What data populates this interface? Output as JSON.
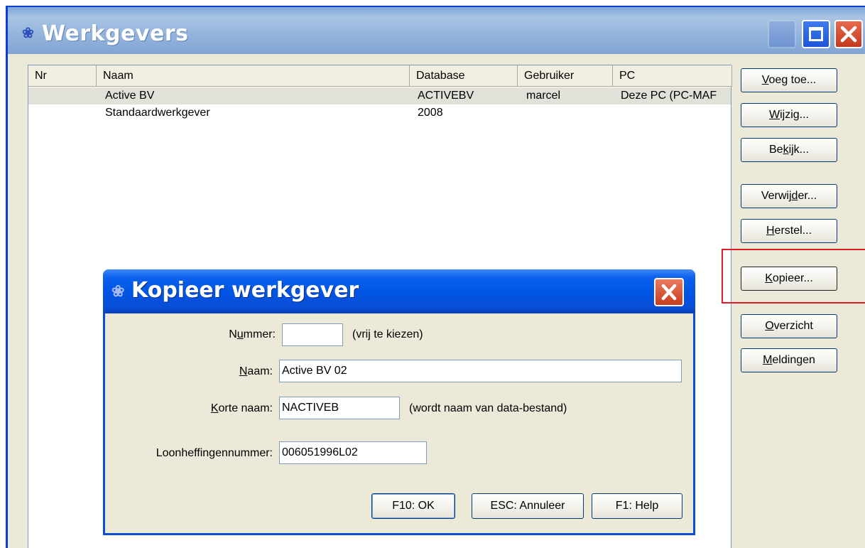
{
  "main": {
    "title": "Werkgevers",
    "columns": [
      "Nr",
      "Naam",
      "Database",
      "Gebruiker",
      "PC"
    ],
    "rows": [
      {
        "nr": "",
        "naam": "Active BV",
        "database": "ACTIVEBV",
        "gebruiker": "marcel",
        "pc": "Deze PC (PC-MAF"
      },
      {
        "nr": "",
        "naam": "Standaardwerkgever",
        "database": "2008",
        "gebruiker": "",
        "pc": ""
      }
    ],
    "buttons": {
      "voeg_toe": {
        "pre": "",
        "key": "V",
        "post": "oeg toe..."
      },
      "wijzig": {
        "pre": "",
        "key": "W",
        "post": "ijzig..."
      },
      "bekijk": {
        "pre": "Be",
        "key": "k",
        "post": "ijk..."
      },
      "verwijder": {
        "pre": "Verwij",
        "key": "d",
        "post": "er..."
      },
      "herstel": {
        "pre": "",
        "key": "H",
        "post": "erstel..."
      },
      "kopieer": {
        "pre": "",
        "key": "K",
        "post": "opieer..."
      },
      "overzicht": {
        "pre": "",
        "key": "O",
        "post": "verzicht"
      },
      "meldingen": {
        "pre": "",
        "key": "M",
        "post": "eldingen"
      }
    }
  },
  "dialog": {
    "title": "Kopieer werkgever",
    "nummer": {
      "label_pre": "N",
      "label_key": "u",
      "label_post": "mmer:",
      "value": "",
      "hint": "(vrij te kiezen)"
    },
    "naam": {
      "label_pre": "",
      "label_key": "N",
      "label_post": "aam:",
      "value": "Active BV 02"
    },
    "korte_naam": {
      "label_pre": "",
      "label_key": "K",
      "label_post": "orte naam:",
      "value": "NACTIVEB",
      "hint": "(wordt naam van data-bestand)"
    },
    "loonheffingennummer": {
      "label": "Loonheffingennummer:",
      "value": "006051996L02"
    },
    "buttons": {
      "ok": "F10: OK",
      "cancel": "ESC: Annuleer",
      "help": "F1: Help"
    }
  },
  "icons": {
    "app_icon": "app-logo-icon",
    "close": "close-icon",
    "maximize": "maximize-icon",
    "minimize": "minimize-icon"
  },
  "colors": {
    "highlight": "#e01b24",
    "titlebar_active": "#0054e3",
    "titlebar_inactive": "#93b3dc"
  }
}
